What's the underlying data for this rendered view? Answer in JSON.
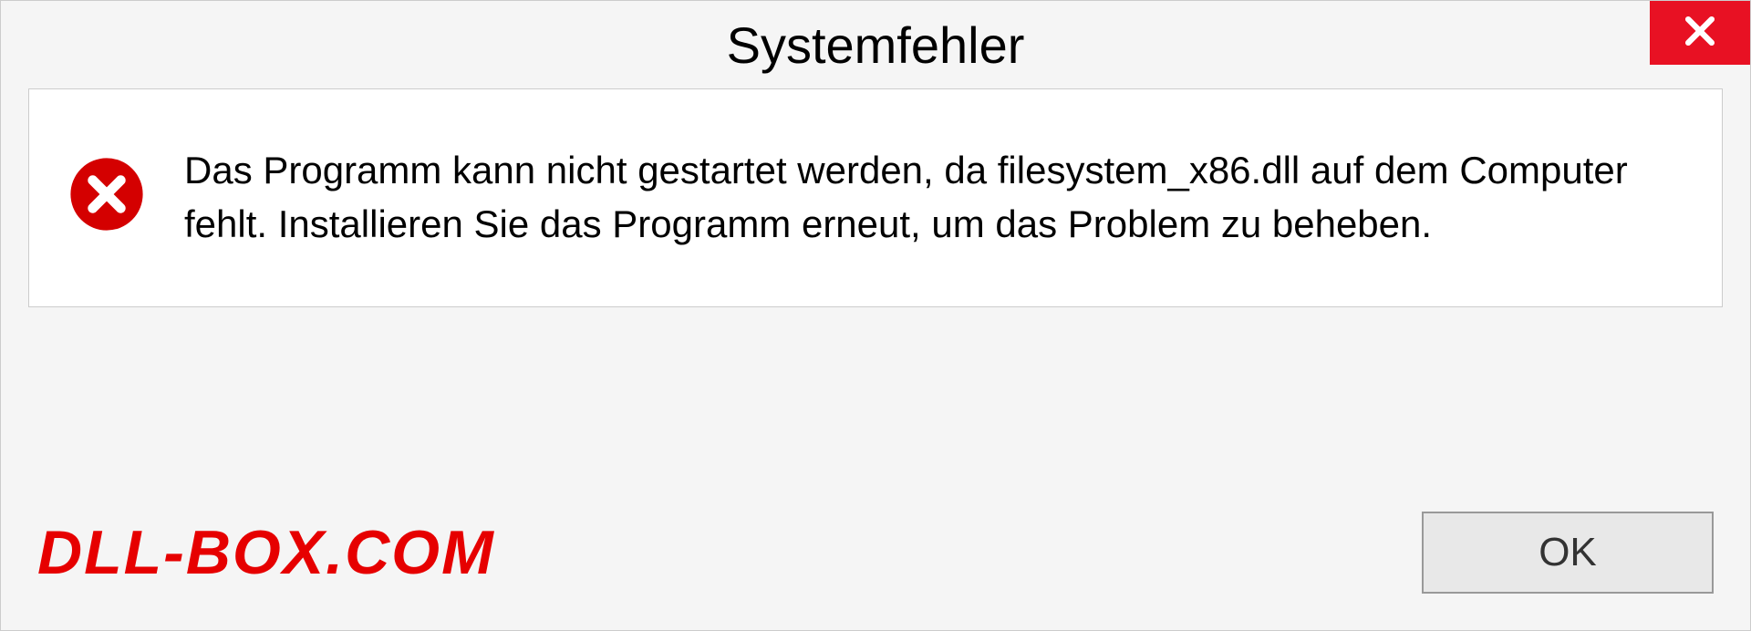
{
  "dialog": {
    "title": "Systemfehler",
    "message": "Das Programm kann nicht gestartet werden, da filesystem_x86.dll auf dem Computer fehlt. Installieren Sie das Programm erneut, um das Problem zu beheben.",
    "ok_label": "OK"
  },
  "watermark": "DLL-BOX.COM",
  "colors": {
    "close_bg": "#e81123",
    "error_icon": "#d40000",
    "watermark": "#e60000"
  }
}
